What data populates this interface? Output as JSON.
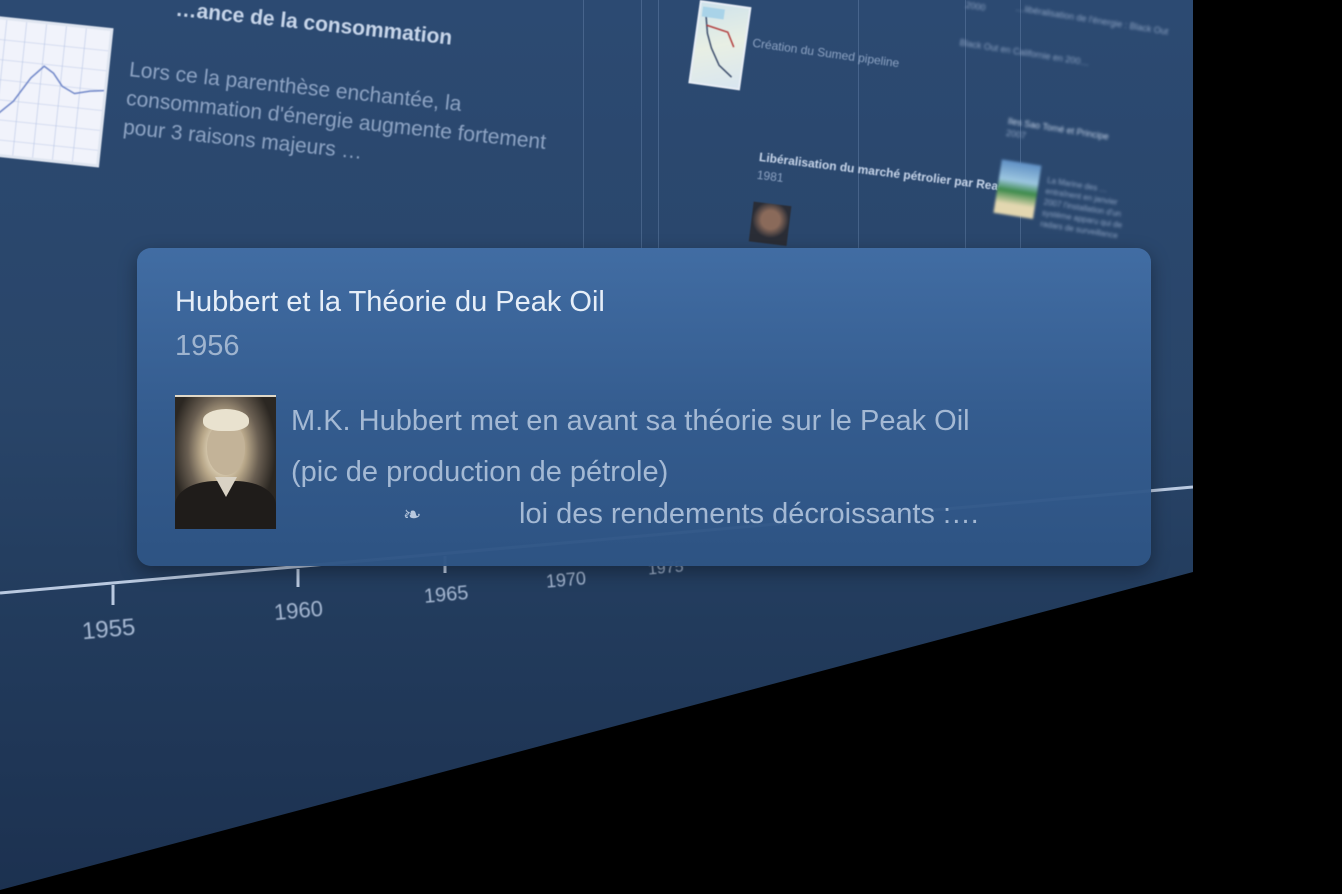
{
  "background_items": {
    "consommation_title": "…ance de la consommation",
    "consommation_body": "Lors ce la parenthèse enchantée, la consommation d'énergie augmente fortement pour 3 raisons majeurs …",
    "sumed_label": "Création du Sumed pipeline",
    "reagan_title": "Libéralisation du marché pétrolier par Reagan",
    "reagan_year": "1981",
    "far_year_2000": "2000",
    "far_label_top": "…libéralisation de l'énergie : Black Out",
    "far_label_blackout": "Black Out en Californie en 200…",
    "far_label_sao_tome": "Iles Sao Tomé et Principe",
    "far_year_2007": "2007",
    "far_label_body": "La Marine des … entraînent en janvier 2007 l'installation d'un système apparu qui de radars de surveillance"
  },
  "timeline": {
    "ticks": [
      "1955",
      "1960",
      "1965",
      "1970",
      "1975"
    ]
  },
  "popup": {
    "title": "Hubbert et la Théorie du Peak Oil",
    "year": "1956",
    "description_line1": "M.K. Hubbert met en avant sa théorie sur le Peak Oil",
    "description_line2": "(pic de production de pétrole)",
    "more_text": "loi des rendements décroissants :…",
    "fleuron_glyph": "❧",
    "photo_icon": "portrait-photo-hubbert"
  },
  "colors": {
    "wall": "#294569",
    "popup": "#3f6aa0",
    "text_primary": "#e6eef8",
    "text_secondary": "#a4b9d4"
  }
}
